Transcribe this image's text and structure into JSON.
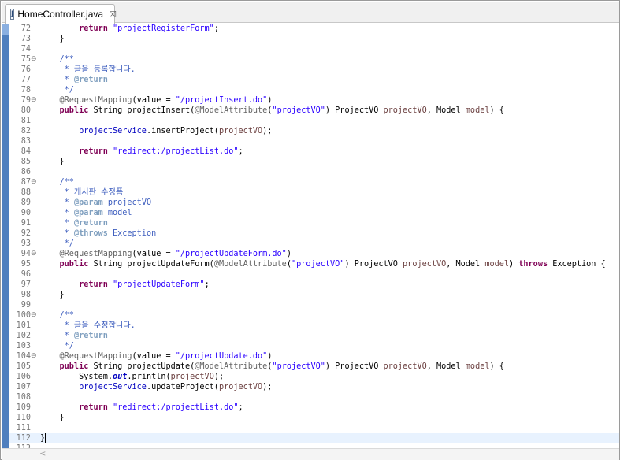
{
  "tab": {
    "icon_letter": "J",
    "title": "HomeController.java",
    "close_glyph": "☒"
  },
  "editor": {
    "current_line": "112",
    "lines": [
      {
        "n": "72",
        "fold": "",
        "t": [
          [
            "kw",
            "        return "
          ],
          [
            "str",
            "\"projectRegisterForm\""
          ],
          [
            "",
            "; "
          ]
        ]
      },
      {
        "n": "73",
        "fold": "",
        "t": [
          [
            "",
            "    }"
          ]
        ]
      },
      {
        "n": "74",
        "fold": "",
        "t": []
      },
      {
        "n": "75",
        "fold": "⊖",
        "t": [
          [
            "cm",
            "    /**"
          ]
        ]
      },
      {
        "n": "76",
        "fold": "",
        "t": [
          [
            "cm",
            "     * 글을 등록합니다."
          ]
        ]
      },
      {
        "n": "77",
        "fold": "",
        "t": [
          [
            "cm",
            "     * "
          ],
          [
            "tag",
            "@return"
          ]
        ]
      },
      {
        "n": "78",
        "fold": "",
        "t": [
          [
            "cm",
            "     */"
          ]
        ]
      },
      {
        "n": "79",
        "fold": "⊖",
        "t": [
          [
            "ann",
            "    @RequestMapping"
          ],
          [
            "",
            "(value = "
          ],
          [
            "str",
            "\"/projectInsert.do\""
          ],
          [
            "",
            ")"
          ]
        ]
      },
      {
        "n": "80",
        "fold": "",
        "t": [
          [
            "kw",
            "    public "
          ],
          [
            "",
            "String projectInsert("
          ],
          [
            "ann",
            "@ModelAttribute"
          ],
          [
            "",
            "("
          ],
          [
            "str",
            "\"projectVO\""
          ],
          [
            "",
            ") ProjectVO "
          ],
          [
            "loc",
            "projectVO"
          ],
          [
            "",
            ", Model "
          ],
          [
            "loc",
            "model"
          ],
          [
            "",
            ") {"
          ]
        ]
      },
      {
        "n": "81",
        "fold": "",
        "t": []
      },
      {
        "n": "82",
        "fold": "",
        "t": [
          [
            "fld",
            "        projectService"
          ],
          [
            "",
            ".insertProject("
          ],
          [
            "loc",
            "projectVO"
          ],
          [
            "",
            ");"
          ]
        ]
      },
      {
        "n": "83",
        "fold": "",
        "t": []
      },
      {
        "n": "84",
        "fold": "",
        "t": [
          [
            "kw",
            "        return "
          ],
          [
            "str",
            "\"redirect:/projectList.do\""
          ],
          [
            "",
            ";"
          ]
        ]
      },
      {
        "n": "85",
        "fold": "",
        "t": [
          [
            "",
            "    }"
          ]
        ]
      },
      {
        "n": "86",
        "fold": "",
        "t": []
      },
      {
        "n": "87",
        "fold": "⊖",
        "t": [
          [
            "cm",
            "    /**"
          ]
        ]
      },
      {
        "n": "88",
        "fold": "",
        "t": [
          [
            "cm",
            "     * 게시판 수정폼"
          ]
        ]
      },
      {
        "n": "89",
        "fold": "",
        "t": [
          [
            "cm",
            "     * "
          ],
          [
            "tag",
            "@param"
          ],
          [
            "cm",
            " projectVO"
          ]
        ]
      },
      {
        "n": "90",
        "fold": "",
        "t": [
          [
            "cm",
            "     * "
          ],
          [
            "tag",
            "@param"
          ],
          [
            "cm",
            " model"
          ]
        ]
      },
      {
        "n": "91",
        "fold": "",
        "t": [
          [
            "cm",
            "     * "
          ],
          [
            "tag",
            "@return"
          ]
        ]
      },
      {
        "n": "92",
        "fold": "",
        "t": [
          [
            "cm",
            "     * "
          ],
          [
            "tag",
            "@throws"
          ],
          [
            "cm",
            " Exception"
          ]
        ]
      },
      {
        "n": "93",
        "fold": "",
        "t": [
          [
            "cm",
            "     */"
          ]
        ]
      },
      {
        "n": "94",
        "fold": "⊖",
        "t": [
          [
            "ann",
            "    @RequestMapping"
          ],
          [
            "",
            "(value = "
          ],
          [
            "str",
            "\"/projectUpdateForm.do\""
          ],
          [
            "",
            ")"
          ]
        ]
      },
      {
        "n": "95",
        "fold": "",
        "t": [
          [
            "kw",
            "    public "
          ],
          [
            "",
            "String projectUpdateForm("
          ],
          [
            "ann",
            "@ModelAttribute"
          ],
          [
            "",
            "("
          ],
          [
            "str",
            "\"projectVO\""
          ],
          [
            "",
            ") ProjectVO "
          ],
          [
            "loc",
            "projectVO"
          ],
          [
            "",
            ", Model "
          ],
          [
            "loc",
            "model"
          ],
          [
            "",
            ") "
          ],
          [
            "kw",
            "throws "
          ],
          [
            "",
            "Exception {"
          ]
        ]
      },
      {
        "n": "96",
        "fold": "",
        "t": []
      },
      {
        "n": "97",
        "fold": "",
        "t": [
          [
            "kw",
            "        return "
          ],
          [
            "str",
            "\"projectUpdateForm\""
          ],
          [
            "",
            ";"
          ]
        ]
      },
      {
        "n": "98",
        "fold": "",
        "t": [
          [
            "",
            "    }"
          ]
        ]
      },
      {
        "n": "99",
        "fold": "",
        "t": []
      },
      {
        "n": "100",
        "fold": "⊖",
        "t": [
          [
            "cm",
            "    /**"
          ]
        ]
      },
      {
        "n": "101",
        "fold": "",
        "t": [
          [
            "cm",
            "     * 글을 수정합니다."
          ]
        ]
      },
      {
        "n": "102",
        "fold": "",
        "t": [
          [
            "cm",
            "     * "
          ],
          [
            "tag",
            "@return"
          ]
        ]
      },
      {
        "n": "103",
        "fold": "",
        "t": [
          [
            "cm",
            "     */"
          ]
        ]
      },
      {
        "n": "104",
        "fold": "⊖",
        "t": [
          [
            "ann",
            "    @RequestMapping"
          ],
          [
            "",
            "(value = "
          ],
          [
            "str",
            "\"/projectUpdate.do\""
          ],
          [
            "",
            ")"
          ]
        ]
      },
      {
        "n": "105",
        "fold": "",
        "t": [
          [
            "kw",
            "    public "
          ],
          [
            "",
            "String projectUpdate("
          ],
          [
            "ann",
            "@ModelAttribute"
          ],
          [
            "",
            "("
          ],
          [
            "str",
            "\"projectVO\""
          ],
          [
            "",
            ") ProjectVO "
          ],
          [
            "loc",
            "projectVO"
          ],
          [
            "",
            ", Model "
          ],
          [
            "loc",
            "model"
          ],
          [
            "",
            ") {"
          ]
        ]
      },
      {
        "n": "106",
        "fold": "",
        "t": [
          [
            "",
            "        System."
          ],
          [
            "st",
            "out"
          ],
          [
            "",
            ".println("
          ],
          [
            "loc",
            "projectVO"
          ],
          [
            "",
            ");"
          ]
        ]
      },
      {
        "n": "107",
        "fold": "",
        "t": [
          [
            "fld",
            "        projectService"
          ],
          [
            "",
            ".updateProject("
          ],
          [
            "loc",
            "projectVO"
          ],
          [
            "",
            ");"
          ]
        ]
      },
      {
        "n": "108",
        "fold": "",
        "t": []
      },
      {
        "n": "109",
        "fold": "",
        "t": [
          [
            "kw",
            "        return "
          ],
          [
            "str",
            "\"redirect:/projectList.do\""
          ],
          [
            "",
            ";"
          ]
        ]
      },
      {
        "n": "110",
        "fold": "",
        "t": [
          [
            "",
            "    }"
          ]
        ]
      },
      {
        "n": "111",
        "fold": "",
        "t": []
      },
      {
        "n": "112",
        "fold": "",
        "t": [
          [
            "",
            "}"
          ]
        ]
      },
      {
        "n": "113",
        "fold": "",
        "t": []
      }
    ]
  },
  "hscroll": {
    "left_arrow": "<"
  },
  "colors": {
    "keyword": "#7f0055",
    "string": "#2a00ff",
    "javadoc": "#3f5fbf",
    "javadoc_tag": "#7f9fbf",
    "annotation": "#646464",
    "field": "#0000c0",
    "local_variable": "#6a3e3e",
    "line_number": "#787878",
    "ruler": "#4f7fbe",
    "current_line": "#e8f2fe"
  }
}
